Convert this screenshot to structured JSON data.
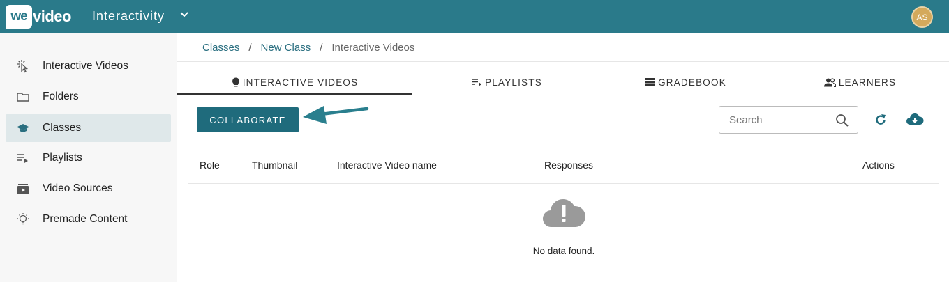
{
  "header": {
    "logo_badge": "we",
    "logo_text": "video",
    "app_title": "Interactivity",
    "avatar_initials": "AS",
    "brand_color": "#2a7a8a"
  },
  "sidebar": {
    "items": [
      {
        "label": "Interactive Videos",
        "icon": "cursor-click-icon",
        "active": false
      },
      {
        "label": "Folders",
        "icon": "folder-icon",
        "active": false
      },
      {
        "label": "Classes",
        "icon": "graduation-cap-icon",
        "active": true
      },
      {
        "label": "Playlists",
        "icon": "playlist-icon",
        "active": false
      },
      {
        "label": "Video Sources",
        "icon": "video-library-icon",
        "active": false
      },
      {
        "label": "Premade Content",
        "icon": "lightbulb-icon",
        "active": false
      }
    ]
  },
  "breadcrumb": {
    "items": [
      "Classes",
      "New Class",
      "Interactive Videos"
    ],
    "separator": "/"
  },
  "tabs": [
    {
      "label": "INTERACTIVE VIDEOS",
      "icon": "lightbulb-icon",
      "active": true
    },
    {
      "label": "PLAYLISTS",
      "icon": "playlist-play-icon",
      "active": false
    },
    {
      "label": "GRADEBOOK",
      "icon": "list-icon",
      "active": false
    },
    {
      "label": "LEARNERS",
      "icon": "people-icon",
      "active": false
    }
  ],
  "toolbar": {
    "collaborate_label": "COLLABORATE",
    "search_placeholder": "Search"
  },
  "table": {
    "columns": [
      "Role",
      "Thumbnail",
      "Interactive Video name",
      "Responses",
      "Actions"
    ],
    "rows": [],
    "empty_message": "No data found."
  }
}
